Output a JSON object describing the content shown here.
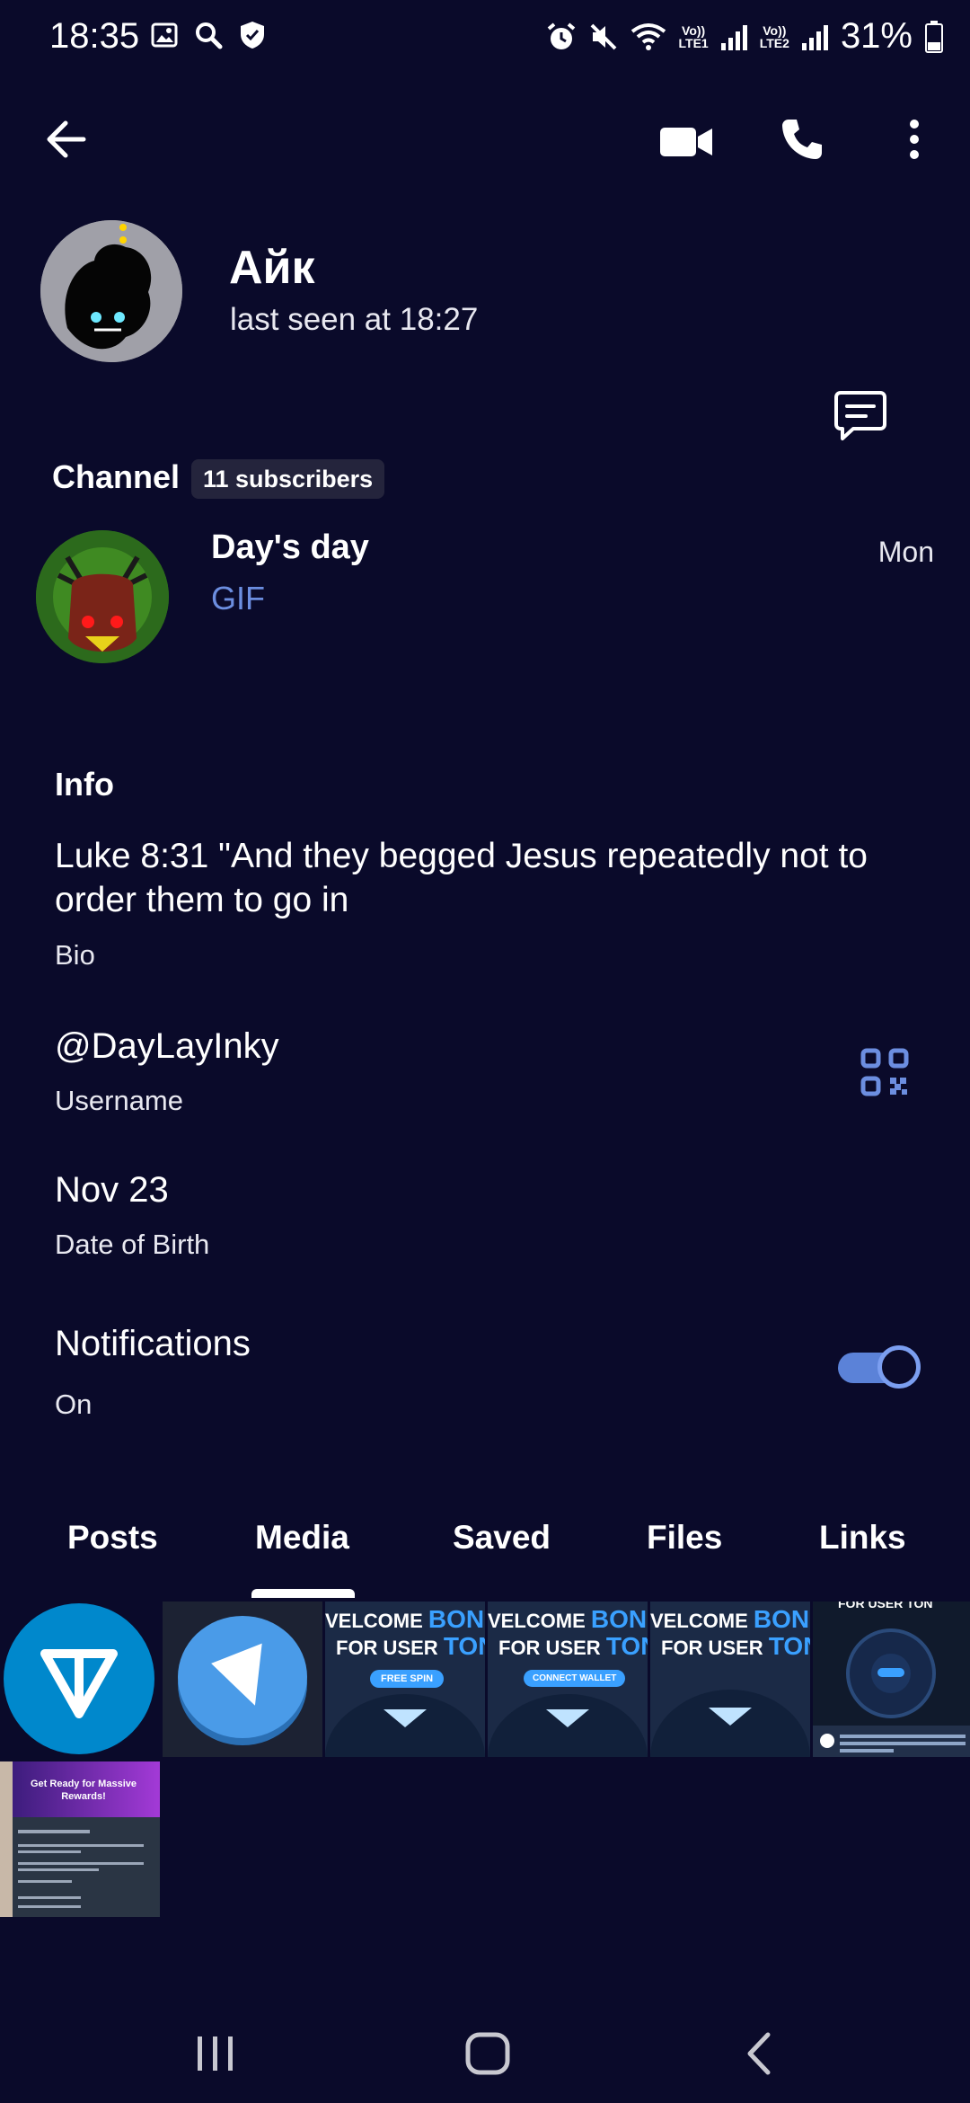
{
  "status_bar": {
    "time": "18:35",
    "left_icons": [
      "image-icon",
      "search-icon",
      "shield-icon"
    ],
    "right_icons": [
      "alarm-icon",
      "mute-icon",
      "wifi-icon"
    ],
    "sim1_top": "Vo))",
    "sim1_bottom": "LTE1",
    "sim2_top": "Vo))",
    "sim2_bottom": "LTE2",
    "battery": "31%"
  },
  "top_bar": {
    "back_icon": "arrow-left-icon",
    "video_icon": "video-call-icon",
    "call_icon": "phone-icon",
    "more_icon": "more-vertical-icon"
  },
  "profile": {
    "name": "Айк",
    "last_seen": "last seen at 18:27",
    "message_icon": "message-icon"
  },
  "channel": {
    "label": "Channel",
    "subscribers": "11 subscribers",
    "title": "Day's day",
    "subtitle": "GIF",
    "time": "Mon"
  },
  "info": {
    "title": "Info",
    "bio": "Luke 8:31 \"And they begged Jesus repeatedly not to order them to go in",
    "bio_caption": "Bio",
    "username": "@DayLayInky",
    "username_caption": "Username",
    "birthday": "Nov 23",
    "birthday_caption": "Date of Birth",
    "notifications": "Notifications",
    "notifications_state": "On",
    "notifications_enabled": true
  },
  "tabs": {
    "items": [
      "Posts",
      "Media",
      "Saved",
      "Files",
      "Links"
    ],
    "active": "Media"
  },
  "media": {
    "promo_welcome": "VELCOME",
    "promo_bonus": "BONU",
    "promo_for_user": "FOR USER",
    "promo_ton": "TON",
    "btn_free_spin": "FREE SPIN",
    "btn_connect_wallet": "CONNECT WALLET",
    "for_user_ton": "FOR USER TON",
    "rewards_title": "Get Ready for Massive Rewards!"
  },
  "colors": {
    "background": "#0a0a2a",
    "accent": "#5b82d8",
    "link": "#6c8ee0",
    "badge": "#24243c"
  }
}
